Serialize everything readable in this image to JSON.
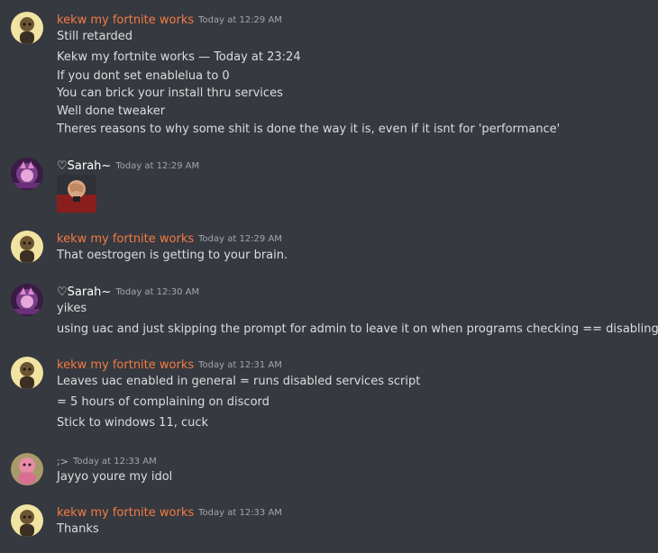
{
  "colors": {
    "background": "#36393f",
    "text": "#dcddde",
    "timestamp": "#a3a6aa",
    "kekw_name": "#f47b43",
    "sarah_name": "#ffffff",
    "anon_name": "#b9bbbe"
  },
  "messages": [
    {
      "author": "kekw my fortnite works",
      "avatar": "kekw-avatar-icon",
      "timestamp": "Today at 12:29 AM",
      "lines": [
        "Still retarded",
        "Kekw my fortnite works — Today at 23:24",
        "If you dont set enablelua to 0",
        "You can brick your install thru services",
        "Well done tweaker",
        "Theres reasons to why some shit is done the way it is, even if it isnt for 'performance'"
      ]
    },
    {
      "author": "♡Sarah~",
      "avatar": "sarah-avatar-icon",
      "timestamp": "Today at 12:29 AM",
      "attachment": "facepalm-image"
    },
    {
      "author": "kekw my fortnite works",
      "avatar": "kekw-avatar-icon",
      "timestamp": "Today at 12:29 AM",
      "lines": [
        "That oestrogen is getting to your brain."
      ]
    },
    {
      "author": "♡Sarah~",
      "avatar": "sarah-avatar-icon",
      "timestamp": "Today at 12:30 AM",
      "lines": [
        "yikes",
        "using uac and just skipping the prompt for admin to leave it on when programs checking == disabling uac"
      ]
    },
    {
      "author": "kekw my fortnite works",
      "avatar": "kekw-avatar-icon",
      "timestamp": "Today at 12:31 AM",
      "lines": [
        "Leaves uac enabled in general = runs disabled services script",
        "= 5 hours of complaining on discord",
        "Stick to windows 11, cuck"
      ]
    },
    {
      "author": ";>",
      "avatar": "pink-panther-avatar-icon",
      "timestamp": "Today at 12:33 AM",
      "lines": [
        "Jayyo youre my idol"
      ]
    },
    {
      "author": "kekw my fortnite works",
      "avatar": "kekw-avatar-icon",
      "timestamp": "Today at 12:33 AM",
      "lines": [
        "Thanks"
      ]
    }
  ]
}
